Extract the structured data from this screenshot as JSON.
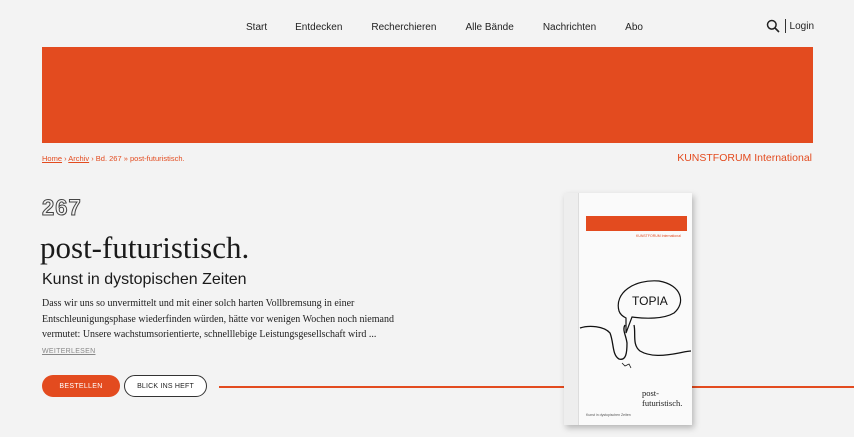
{
  "nav": {
    "items": [
      "Start",
      "Entdecken",
      "Recherchieren",
      "Alle Bände",
      "Nachrichten",
      "Abo"
    ]
  },
  "utils": {
    "login": "Login"
  },
  "colors": {
    "accent": "#e34b1f",
    "background": "#f3f3f3"
  },
  "breadcrumb": {
    "home": "Home",
    "sep1": " › ",
    "archive": "Archiv",
    "sep2": " › ",
    "volume": "Bd. 267",
    "sep3": " » ",
    "current": "post-futuristisch."
  },
  "brand": "KUNSTFORUM International",
  "hero": {
    "volume_number": "267",
    "title": "post-futuristisch.",
    "subtitle": "Kunst in dystopischen Zeiten",
    "description": "Dass wir uns so unvermittelt und mit einer solch harten Vollbremsung in einer Entschleunigungsphase wiederfinden würden, hätte vor wenigen Wochen noch niemand vermutet: Unsere wachstumsorientierte, schnelllebige Leistungsgesellschaft wird ... ",
    "read_more": "WEITERLESEN",
    "order_button": "BESTELLEN",
    "preview_button": "BLICK INS HEFT"
  },
  "cover": {
    "bubble_text": "TOPIA",
    "title": "post-futuristisch.",
    "subtitle": "Kunst in dystopischen Zeiten",
    "masthead_small": "KUNSTFORUM International",
    "icons": [
      "search-icon"
    ]
  }
}
